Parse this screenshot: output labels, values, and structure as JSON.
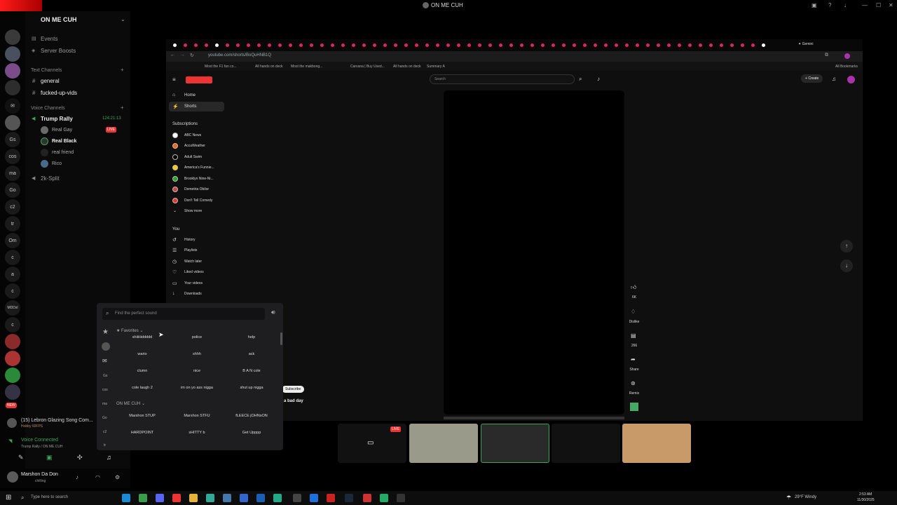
{
  "window": {
    "title": "ON ME CUH"
  },
  "discord": {
    "server_name": "ON ME CUH",
    "menu": [
      "Events",
      "Server Boosts"
    ],
    "text_channels_label": "Text Channels",
    "text_channels": [
      "general",
      "fucked-up-vids"
    ],
    "voice_channels_label": "Voice Channels",
    "voice_channel": {
      "name": "Trump Rally",
      "timer": "124:21:13"
    },
    "voice_members": [
      {
        "name": "Real Gay",
        "badge": "LIVE"
      },
      {
        "name": "Real Black"
      },
      {
        "name": "real friend"
      },
      {
        "name": "Rico"
      }
    ],
    "other_voice": "2k-Split",
    "guild_labels": [
      "Gs",
      "cos",
      "ma",
      "Go",
      "c2",
      "tr",
      "Om",
      "c",
      "a",
      "c",
      "MDDxl",
      "c"
    ],
    "guild_badge": "NEW",
    "activity": {
      "title": "(15) Lebron Glazing Song Com...",
      "sub": "Hobby 60FPS"
    },
    "voice_status": {
      "title": "Voice Connected",
      "sub": "Trump Rally / ON ME CUH"
    },
    "user": {
      "name": "Marshon Da Don",
      "status": "chilling"
    }
  },
  "browser": {
    "url": "youtube.com/shorts/BoQuHNB1Q",
    "bookmarks": [
      "Most the F1 fan co...",
      "All hands on deck",
      "Most the makbong...",
      "Carvana | Buy Used...",
      "All hands on deck",
      "Summary A"
    ],
    "all_bookmarks": "All Bookmarks",
    "gemini": "Gemini"
  },
  "youtube": {
    "search_placeholder": "Search",
    "create": "Create",
    "nav": [
      "Home",
      "Shorts"
    ],
    "subscriptions_label": "Subscriptions",
    "subscriptions": [
      "ABC News",
      "AccuWeather",
      "Adult Swim",
      "America's Funnie...",
      "Brooklyn Nine-Ni...",
      "Demetria Obilor",
      "Don't Tell Comedy"
    ],
    "show_more": "Show more",
    "you_label": "You",
    "you_items": [
      "History",
      "Playlists",
      "Watch later",
      "Liked videos",
      "Your videos",
      "Downloads"
    ],
    "actions": {
      "likes": "6K",
      "dislike": "Dislike",
      "comments": "266",
      "share": "Share",
      "remix": "Remix"
    },
    "subscribe": "Subscribe",
    "caption": "a bad day"
  },
  "soundboard": {
    "search_placeholder": "Find the perfect sound",
    "favorites_label": "Favorites",
    "favorites": [
      "shiiiiiiddddd",
      "police",
      "help",
      "wario",
      "shhh",
      "ack",
      "clumn",
      "nice",
      "B A N cole",
      "cole laugh 2",
      "im on yo ass nigga",
      "shut up nigga"
    ],
    "server_label": "ON ME CUH",
    "server_sounds": [
      "Marshon STUP",
      "Marshon STFU",
      "fLEECE jOHNsON",
      "HARDPOINT",
      "sHITTY b",
      "Get Upppp"
    ],
    "rail_labels": [
      "Gs",
      "cos",
      "ma",
      "Go",
      "c2",
      "tr"
    ]
  },
  "stream": {
    "live_badge": "LIVE"
  },
  "taskbar": {
    "search": "Type here to search",
    "weather": "29°F Windy",
    "time": "2:53 AM",
    "date": "11/30/2025"
  }
}
